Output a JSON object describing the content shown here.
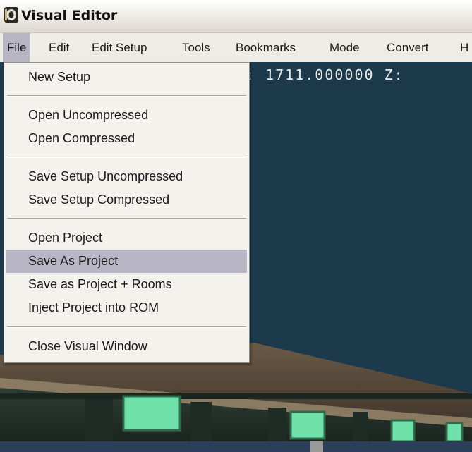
{
  "window": {
    "title": "Visual Editor"
  },
  "menubar": {
    "items": [
      "File",
      "Edit",
      "Edit Setup",
      "Tools",
      "Bookmarks",
      "Mode",
      "Convert",
      "H"
    ]
  },
  "viewport": {
    "coords_text": ": 1711.000000 Z:"
  },
  "file_menu": {
    "items": [
      "New Setup",
      "Open Uncompressed",
      "Open Compressed",
      "Save Setup Uncompressed",
      "Save Setup Compressed",
      "Open Project",
      "Save As Project",
      "Save as Project + Rooms",
      "Inject Project into ROM",
      "Close Visual Window"
    ],
    "highlighted": "Save As Project"
  },
  "colors": {
    "menu_highlight": "#b8b6c4",
    "viewport_bg": "#1d3a4d",
    "glow_panel": "#6fe0a8"
  }
}
